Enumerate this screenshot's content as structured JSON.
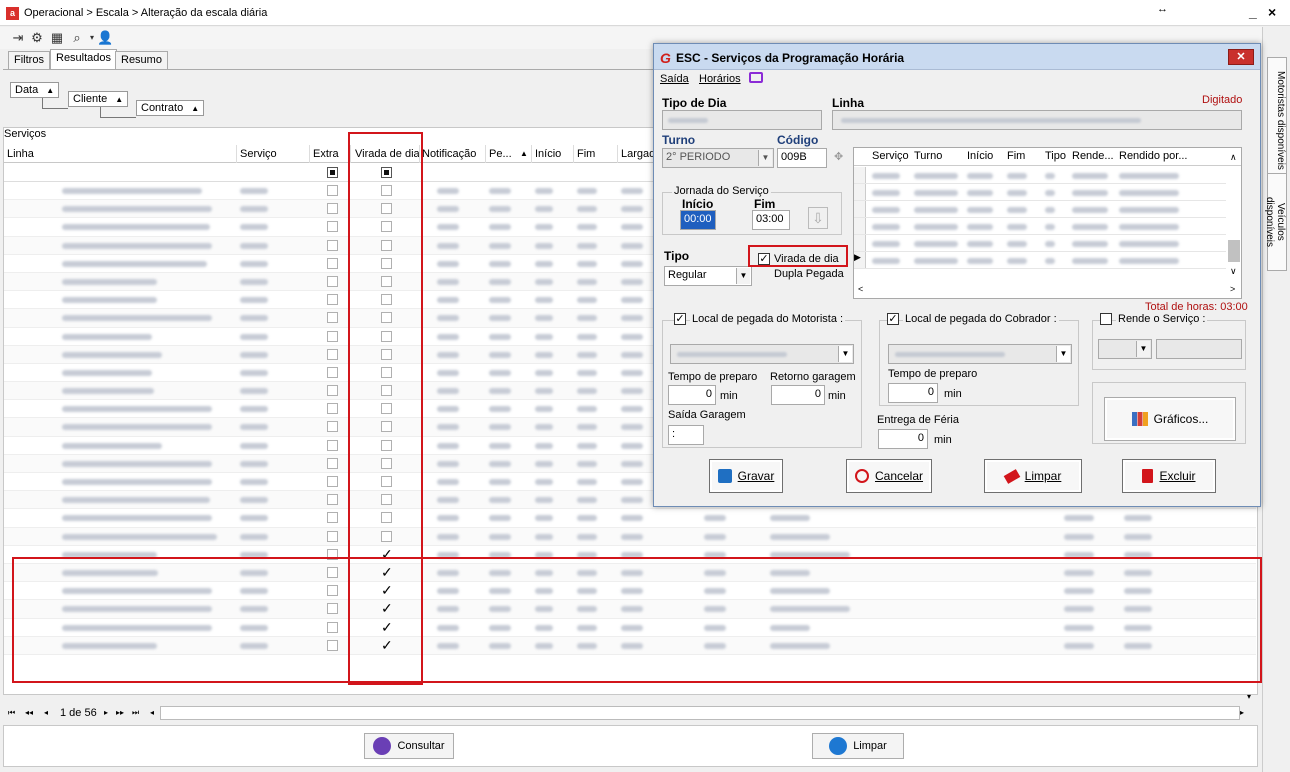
{
  "window": {
    "breadcrumb": "Operacional > Escala > Alteração da escala diária",
    "app_icon_letter": "a",
    "restore_glyph": "↔",
    "minimize_glyph": "_",
    "close_glyph": "×"
  },
  "toolbar_icons": [
    "export-icon",
    "settings-icon",
    "grid-icon",
    "search-icon",
    "user-icon"
  ],
  "tabs": [
    {
      "label": "Filtros",
      "active": false
    },
    {
      "label": "Resultados",
      "active": true
    },
    {
      "label": "Resumo",
      "active": false
    }
  ],
  "group_headers": {
    "data": "Data",
    "cliente": "Cliente",
    "contrato": "Contrato"
  },
  "grid": {
    "section_label": "Serviços",
    "columns": {
      "linha": "Linha",
      "servico": "Serviço",
      "extra": "Extra",
      "virada": "Virada de dia",
      "notificacao": "Notificação",
      "pe": "Pe...",
      "inicio": "Início",
      "fim": "Fim",
      "largada": "Largad"
    },
    "virada_checked": [
      false,
      false,
      false,
      false,
      false,
      false,
      false,
      false,
      false,
      false,
      false,
      false,
      false,
      false,
      false,
      false,
      false,
      false,
      false,
      false,
      true,
      true,
      true,
      true,
      true,
      true
    ]
  },
  "pager": {
    "first": "⏮",
    "prev_page": "◂◂",
    "prev": "◂",
    "page_text": "1 de 56",
    "next": "▸",
    "next_page": "▸▸",
    "last": "⏭",
    "scroll_left": "◂",
    "scroll_right": "▸",
    "scroll_down": "▾"
  },
  "bottom_buttons": {
    "consultar": "Consultar",
    "limpar": "Limpar"
  },
  "side_tabs": {
    "motoristas": "Motoristas disponíveis",
    "veiculos": "Veículos disponíveis"
  },
  "dialog": {
    "logo": "G",
    "title": "ESC - Serviços da Programação Horária",
    "close_glyph": "✕",
    "menu": {
      "saida": "Saída",
      "horarios": "Horários"
    },
    "tipo_dia_label": "Tipo de Dia",
    "linha_label": "Linha",
    "status": "Digitado",
    "turno_label": "Turno",
    "turno_value": "2° PERIODO",
    "codigo_label": "Código",
    "codigo_value": "009B",
    "add_glyph": "✥",
    "jornada_label": "Jornada do Serviço",
    "inicio_label": "Início",
    "inicio_value": "00:00",
    "fim_label": "Fim",
    "fim_value": "03:00",
    "down_glyph": "⇩",
    "tipo_label": "Tipo",
    "tipo_value": "Regular",
    "virada_label": "Virada de dia",
    "virada_checked": true,
    "dupla_label": "Dupla Pegada",
    "sub_grid_columns": [
      "Serviço",
      "Turno",
      "Início",
      "Fim",
      "Tipo",
      "Rende...",
      "Rendido por..."
    ],
    "total_horas": "Total de horas: 03:00",
    "local_motorista_label": "Local de pegada do Motorista :",
    "local_cobrador_label": "Local de pegada do Cobrador :",
    "rende_label": "Rende o Serviço :",
    "tempo_preparo_label": "Tempo de preparo",
    "tempo_preparo_motorista": "0",
    "retorno_garagem_label": "Retorno garagem",
    "retorno_garagem_value": "0",
    "min_unit": "min",
    "saida_garagem_label": "Saída Garagem",
    "saida_garagem_value": ":",
    "tempo_preparo_cobrador": "0",
    "entrega_feria_label": "Entrega de Féria",
    "entrega_feria_value": "0",
    "graficos_label": "Gráficos...",
    "buttons": {
      "gravar": "Gravar",
      "cancelar": "Cancelar",
      "limpar": "Limpar",
      "excluir": "Excluir"
    }
  },
  "colors": {
    "highlight": "#d2151b",
    "accent": "#1f5fbf",
    "brand": "#d9302c"
  }
}
